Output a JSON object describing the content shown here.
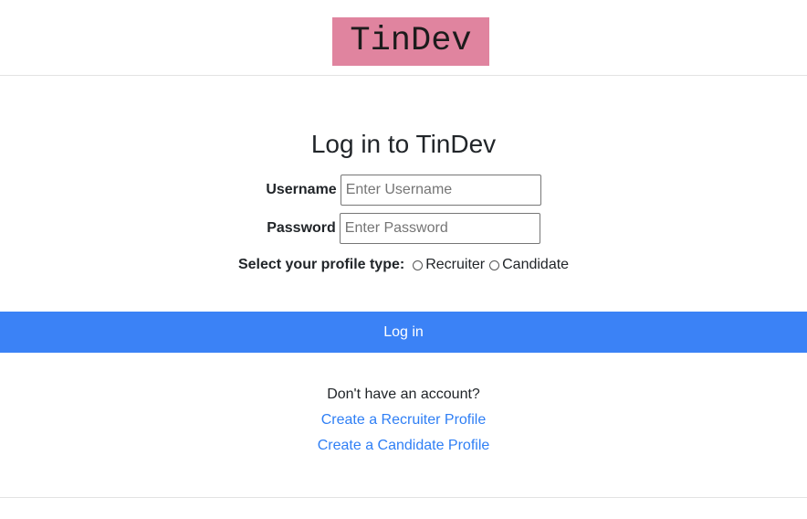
{
  "header": {
    "logo_text": "TinDev"
  },
  "login": {
    "title": "Log in to TinDev",
    "username_label": "Username",
    "username_placeholder": "Enter Username",
    "username_value": "",
    "password_label": "Password",
    "password_placeholder": "Enter Password",
    "password_value": "",
    "profile_type_label": "Select your profile type:",
    "profile_options": [
      "Recruiter",
      "Candidate"
    ],
    "submit_label": "Log in"
  },
  "signup": {
    "prompt": "Don't have an account?",
    "recruiter_link": "Create a Recruiter Profile",
    "candidate_link": "Create a Candidate Profile"
  },
  "colors": {
    "logo_bg": "#e0849f",
    "button_bg": "#3b82f6",
    "link": "#2f7ff5"
  }
}
